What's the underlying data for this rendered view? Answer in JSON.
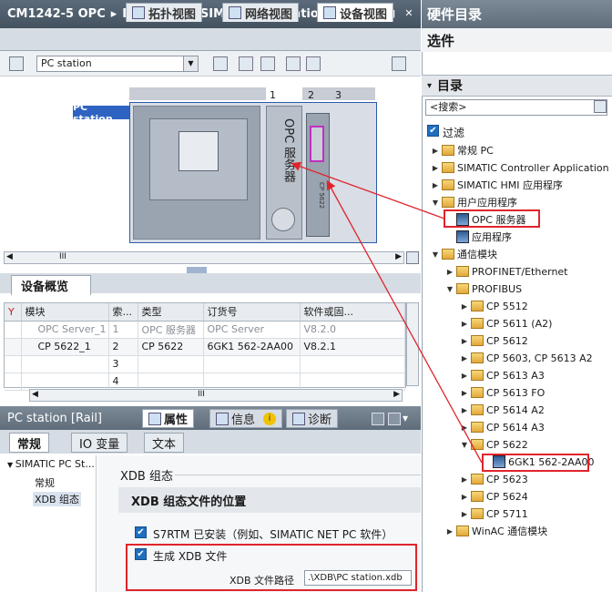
{
  "window": {
    "title_left": "CM1242-5 OPC",
    "title_right": "PC station [SIMATIC PC station]",
    "separator": "▸"
  },
  "view_tabs": [
    {
      "label": "拓扑视图",
      "active": false
    },
    {
      "label": "网络视图",
      "active": false
    },
    {
      "label": "设备视图",
      "active": true
    }
  ],
  "toolbar": {
    "device_select": "PC station"
  },
  "canvas": {
    "slots": [
      "1",
      "2",
      "3"
    ],
    "station_label": "PC station",
    "opc_module_label": "OPC 服务器",
    "cp_module_label": "CP 5622",
    "hscroll_grip": "III"
  },
  "overview": {
    "tab_label": "设备概览",
    "columns": [
      "",
      "模块",
      "索...",
      "类型",
      "订货号",
      "软件或固..."
    ],
    "rows": [
      {
        "module": "OPC Server_1",
        "index": "1",
        "type": "OPC 服务器",
        "order": "OPC Server",
        "sw": "V8.2.0",
        "style": "gray"
      },
      {
        "module": "CP 5622_1",
        "index": "2",
        "type": "CP 5622",
        "order": "6GK1 562-2AA00",
        "sw": "V8.2.1",
        "style": "sel"
      },
      {
        "module": "",
        "index": "3",
        "type": "",
        "order": "",
        "sw": "",
        "style": ""
      },
      {
        "module": "",
        "index": "4",
        "type": "",
        "order": "",
        "sw": "",
        "style": ""
      }
    ],
    "hscroll_grip": "III"
  },
  "properties": {
    "title": "PC station [Rail]",
    "tabs": [
      {
        "label": "属性",
        "active": true
      },
      {
        "label": "信息",
        "active": false
      },
      {
        "label": "诊断",
        "active": false
      }
    ],
    "info_badge": "i",
    "subtabs": [
      {
        "label": "常规",
        "active": true
      },
      {
        "label": "IO 变量",
        "active": false
      },
      {
        "label": "文本",
        "active": false
      }
    ],
    "nav": {
      "root": "SIMATIC PC St...",
      "items": [
        "常规",
        "XDB 组态"
      ]
    },
    "content": {
      "group_title": "XDB 组态",
      "section_title": "XDB 组态文件的位置",
      "s7rtm_label": "S7RTM 已安装（例如、SIMATIC NET PC 软件）",
      "generate_label": "生成 XDB 文件",
      "path_label": "XDB 文件路径",
      "path_value": ".\\XDB\\PC station.xdb",
      "check_mark": "✔"
    }
  },
  "catalog": {
    "title": "硬件目录",
    "options_label": "选件",
    "catalog_label": "目录",
    "search_placeholder": "<搜索>",
    "filter_label": "过滤",
    "items": [
      {
        "label": "常规 PC",
        "level": 0,
        "exp": "▶",
        "icon": "folder"
      },
      {
        "label": "SIMATIC Controller Application",
        "level": 0,
        "exp": "▶",
        "icon": "folder"
      },
      {
        "label": "SIMATIC HMI 应用程序",
        "level": 0,
        "exp": "▶",
        "icon": "folder"
      },
      {
        "label": "用户应用程序",
        "level": 0,
        "exp": "▼",
        "icon": "folder"
      },
      {
        "label": "OPC 服务器",
        "level": 1,
        "exp": "",
        "icon": "module"
      },
      {
        "label": "应用程序",
        "level": 1,
        "exp": "",
        "icon": "module"
      },
      {
        "label": "通信模块",
        "level": 0,
        "exp": "▼",
        "icon": "folder"
      },
      {
        "label": "PROFINET/Ethernet",
        "level": 1,
        "exp": "▶",
        "icon": "folder"
      },
      {
        "label": "PROFIBUS",
        "level": 1,
        "exp": "▼",
        "icon": "folder"
      },
      {
        "label": "CP 5512",
        "level": 2,
        "exp": "▶",
        "icon": "folder"
      },
      {
        "label": "CP 5611 (A2)",
        "level": 2,
        "exp": "▶",
        "icon": "folder"
      },
      {
        "label": "CP 5612",
        "level": 2,
        "exp": "▶",
        "icon": "folder"
      },
      {
        "label": "CP 5603, CP 5613 A2",
        "level": 2,
        "exp": "▶",
        "icon": "folder"
      },
      {
        "label": "CP 5613 A3",
        "level": 2,
        "exp": "▶",
        "icon": "folder"
      },
      {
        "label": "CP 5613 FO",
        "level": 2,
        "exp": "▶",
        "icon": "folder"
      },
      {
        "label": "CP 5614 A2",
        "level": 2,
        "exp": "▶",
        "icon": "folder"
      },
      {
        "label": "CP 5614 A3",
        "level": 2,
        "exp": "▶",
        "icon": "folder"
      },
      {
        "label": "CP 5622",
        "level": 2,
        "exp": "▼",
        "icon": "folder"
      },
      {
        "label": "6GK1 562-2AA00",
        "level": 3,
        "exp": "",
        "icon": "module"
      },
      {
        "label": "CP 5623",
        "level": 2,
        "exp": "▶",
        "icon": "folder"
      },
      {
        "label": "CP 5624",
        "level": 2,
        "exp": "▶",
        "icon": "folder"
      },
      {
        "label": "CP 5711",
        "level": 2,
        "exp": "▶",
        "icon": "folder"
      },
      {
        "label": "WinAC 通信模块",
        "level": 1,
        "exp": "▶",
        "icon": "folder"
      }
    ]
  }
}
